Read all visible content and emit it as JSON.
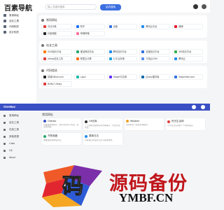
{
  "top": {
    "logo": "百素导航",
    "search_placeholder": "输入关键词搜索",
    "search_button": "站内搜索",
    "sidebar": [
      {
        "label": "常用网址",
        "icon": "star-icon"
      },
      {
        "label": "站长工具",
        "icon": "tool-icon"
      },
      {
        "label": "代码相关",
        "icon": "code-icon"
      },
      {
        "label": "设计相关",
        "icon": "palette-icon"
      }
    ],
    "sections": [
      {
        "title": "常用网址",
        "sites": [
          {
            "name": "今日头条",
            "color": "#e03b3b"
          },
          {
            "name": "知乎",
            "color": "#1772f6"
          },
          {
            "name": "百度",
            "color": "#2f6fe0"
          },
          {
            "name": "腾讯云平台",
            "color": "#1f8cf0"
          },
          {
            "name": "微博",
            "color": "#e6162d"
          },
          {
            "name": "抖音视频",
            "color": "#222222"
          },
          {
            "name": "哔哩哔哩",
            "color": "#fb7299"
          }
        ]
      },
      {
        "title": "站长工具",
        "sites": [
          {
            "name": "5118站长平台",
            "color": "#ff7a00"
          },
          {
            "name": "爱站网站平台",
            "color": "#25a76a"
          },
          {
            "name": "腾讯站长平台",
            "color": "#1f8cf0"
          },
          {
            "name": "百度站长平台",
            "color": "#2f6fe0"
          },
          {
            "name": "360站长平台",
            "color": "#34b04a"
          },
          {
            "name": "chinaz站长工具",
            "color": "#e03b3b"
          },
          {
            "name": "阿里云计算",
            "color": "#ff6a00"
          },
          {
            "name": "七牛云存储",
            "color": "#19a2de"
          },
          {
            "name": "又拍云CDN",
            "color": "#5b8def"
          },
          {
            "name": "腾讯云",
            "color": "#1f8cf0"
          }
        ]
      },
      {
        "title": "代码相关",
        "sites": [
          {
            "name": "前端Github.com",
            "color": "#222222"
          },
          {
            "name": "Layui",
            "color": "#16baaa"
          },
          {
            "name": "Swiper中文网",
            "color": "#6332f6"
          },
          {
            "name": "jQuery插件库",
            "color": "#0769ad"
          },
          {
            "name": "Swiperhtml.com",
            "color": "#2f6fe0"
          },
          {
            "name": "BotNo' Library",
            "color": "#e03b3b"
          }
        ]
      }
    ]
  },
  "bottom": {
    "title": "OneNav",
    "sidebar": [
      {
        "label": "常用网址",
        "icon": "star-icon"
      },
      {
        "label": "站长工具",
        "icon": "tool-icon"
      },
      {
        "label": "在线工具",
        "icon": "wrench-icon"
      },
      {
        "label": "其他资源",
        "icon": "folder-icon"
      },
      {
        "label": "Links",
        "icon": "link-icon"
      },
      {
        "label": "Git",
        "icon": "git-icon"
      },
      {
        "label": "About",
        "icon": "info-icon"
      }
    ],
    "section_title": "常用网址",
    "cards": [
      {
        "name": "Onenav",
        "desc": "轻量级导航程序，支持书签导入导出，多主题切换。",
        "color": "#3a4fc4"
      },
      {
        "name": "Git仓库",
        "desc": "一个简单轻量的书签管理程序，代码开源托管。",
        "color": "#333333"
      },
      {
        "name": "Weather",
        "desc": "简洁的天气预报查询服务。",
        "color": "#f0a020"
      },
      {
        "name": "时光生活网",
        "desc": "分享生活点滴的个人博客站点。",
        "color": "#e03b3b"
      },
      {
        "name": "书签收藏",
        "desc": "收藏常用的网站书签。",
        "color": "#25a76a"
      },
      {
        "name": "更新日志",
        "desc": "查看程序的更新记录与版本发布。",
        "color": "#1f8cf0"
      }
    ]
  },
  "watermark": {
    "cn": "源码备份",
    "url": "YMBF.CN",
    "logo_char": "码"
  }
}
